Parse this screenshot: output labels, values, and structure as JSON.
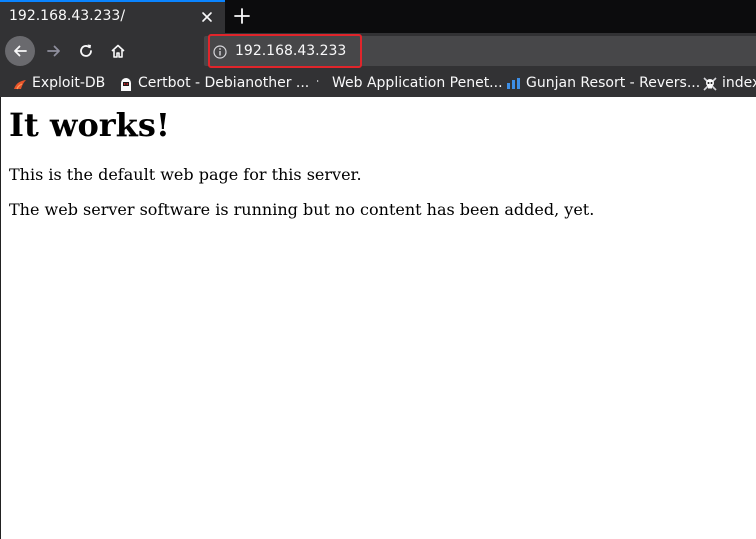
{
  "tab": {
    "title": "192.168.43.233/"
  },
  "navbar": {
    "url": "192.168.43.233"
  },
  "bookmarks": [
    {
      "label": "Exploit-DB",
      "icon": "exploit-db-icon"
    },
    {
      "label": "Certbot - Debianother ...",
      "icon": "certbot-icon"
    },
    {
      "label": "Web Application Penet...",
      "icon": "bookmark-dot-icon"
    },
    {
      "label": "Gunjan Resort - Revers...",
      "icon": "bar-chart-icon"
    },
    {
      "label": "index",
      "icon": "skull-icon"
    }
  ],
  "page": {
    "heading": "It works!",
    "paragraphs": [
      "This is the default web page for this server.",
      "The web server software is running but no content has been added, yet."
    ]
  },
  "colors": {
    "tab_accent": "#0a84ff",
    "toolbar": "#323234",
    "highlight": "#e0252b"
  }
}
